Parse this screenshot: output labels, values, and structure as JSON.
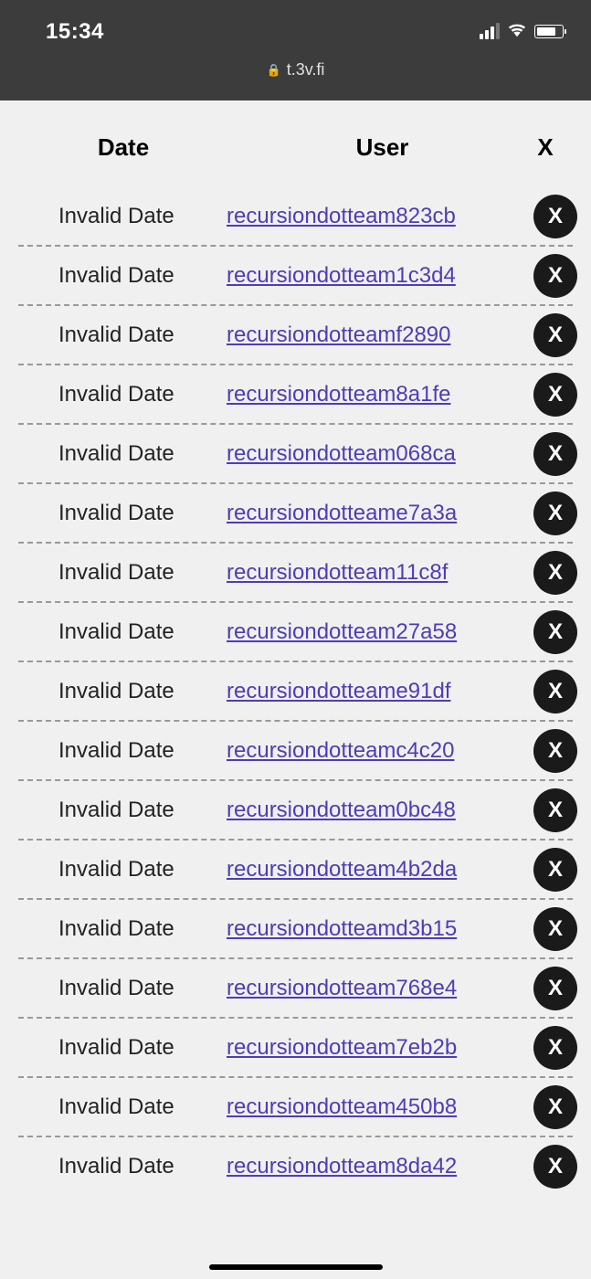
{
  "status_bar": {
    "time": "15:34",
    "url": "t.3v.fi"
  },
  "table": {
    "headers": {
      "date": "Date",
      "user": "User",
      "x": "X"
    },
    "x_button_label": "X",
    "rows": [
      {
        "date": "Invalid Date",
        "user": "recursiondotteam823cb"
      },
      {
        "date": "Invalid Date",
        "user": "recursiondotteam1c3d4"
      },
      {
        "date": "Invalid Date",
        "user": "recursiondotteamf2890"
      },
      {
        "date": "Invalid Date",
        "user": "recursiondotteam8a1fe"
      },
      {
        "date": "Invalid Date",
        "user": "recursiondotteam068ca"
      },
      {
        "date": "Invalid Date",
        "user": "recursiondotteame7a3a"
      },
      {
        "date": "Invalid Date",
        "user": "recursiondotteam11c8f"
      },
      {
        "date": "Invalid Date",
        "user": "recursiondotteam27a58"
      },
      {
        "date": "Invalid Date",
        "user": "recursiondotteame91df"
      },
      {
        "date": "Invalid Date",
        "user": "recursiondotteamc4c20"
      },
      {
        "date": "Invalid Date",
        "user": "recursiondotteam0bc48"
      },
      {
        "date": "Invalid Date",
        "user": "recursiondotteam4b2da"
      },
      {
        "date": "Invalid Date",
        "user": "recursiondotteamd3b15"
      },
      {
        "date": "Invalid Date",
        "user": "recursiondotteam768e4"
      },
      {
        "date": "Invalid Date",
        "user": "recursiondotteam7eb2b"
      },
      {
        "date": "Invalid Date",
        "user": "recursiondotteam450b8"
      },
      {
        "date": "Invalid Date",
        "user": "recursiondotteam8da42"
      }
    ]
  }
}
